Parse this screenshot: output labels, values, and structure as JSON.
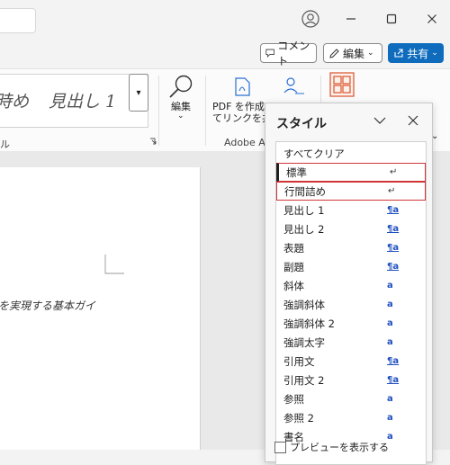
{
  "titlebar": {
    "window_controls": [
      "minimize",
      "maximize",
      "close"
    ]
  },
  "commands": {
    "comment_label": "コメント",
    "edit_label": "編集",
    "share_label": "共有"
  },
  "ribbon": {
    "gallery_partial": "時め",
    "gallery_heading1": "見出し 1",
    "styles_group_partial": "ル",
    "edit_label": "編集",
    "pdf_line1": "PDF を作成",
    "pdf_line2": "てリンクを共",
    "adobe_group": "Adobe A"
  },
  "document": {
    "text": "を実現する基本ガイ"
  },
  "pane": {
    "title": "スタイル",
    "clear_all": "すべてクリア",
    "styles": [
      {
        "name": "標準",
        "mark": "↵"
      },
      {
        "name": "行間詰め",
        "mark": "↵"
      },
      {
        "name": "見出し 1",
        "mark": "¶a"
      },
      {
        "name": "見出し 2",
        "mark": "¶a"
      },
      {
        "name": "表題",
        "mark": "¶a"
      },
      {
        "name": "副題",
        "mark": "¶a"
      },
      {
        "name": "斜体",
        "mark": "a"
      },
      {
        "name": "強調斜体",
        "mark": "a"
      },
      {
        "name": "強調斜体 2",
        "mark": "a"
      },
      {
        "name": "強調太字",
        "mark": "a"
      },
      {
        "name": "引用文",
        "mark": "¶a"
      },
      {
        "name": "引用文 2",
        "mark": "¶a"
      },
      {
        "name": "参照",
        "mark": "a"
      },
      {
        "name": "参照 2",
        "mark": "a"
      },
      {
        "name": "書名",
        "mark": "a"
      }
    ],
    "preview_label": "プレビューを表示する"
  },
  "colors": {
    "accent": "#0f6cbd",
    "highlight": "#d13438"
  }
}
